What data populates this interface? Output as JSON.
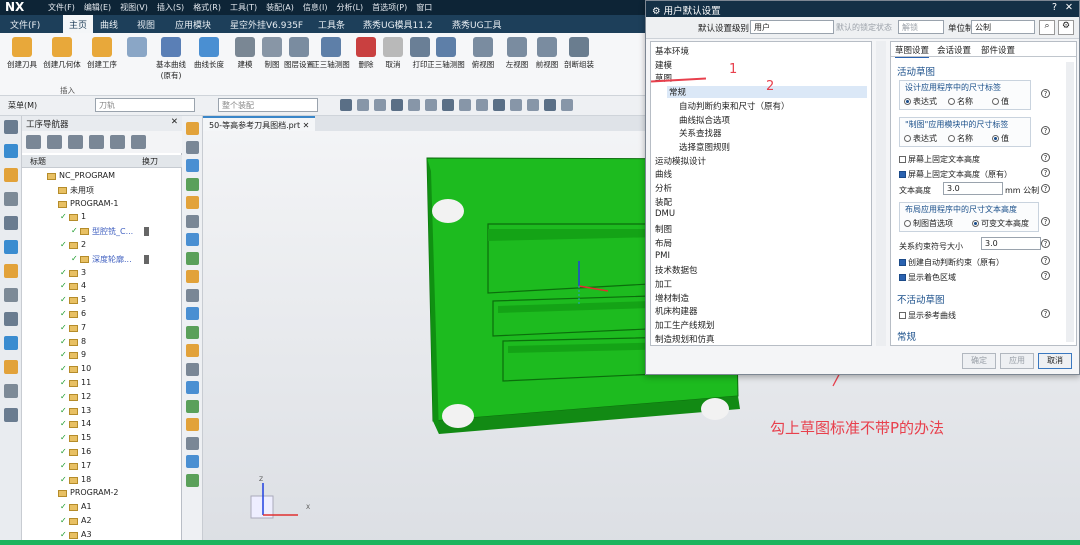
{
  "app": {
    "logo": "NX",
    "menu": [
      "文件(F)",
      "编辑(E)",
      "视图(V)",
      "插入(S)",
      "格式(R)",
      "工具(T)",
      "装配(A)",
      "信息(I)",
      "分析(L)",
      "首选项(P)",
      "窗口"
    ]
  },
  "ribbon_tabs": [
    "文件(F)",
    "主页",
    "曲线",
    "视图",
    "应用模块",
    "星空外挂V6.935F",
    "工具条",
    "燕秀UG模具11.2",
    "燕秀UG工具"
  ],
  "ribbon_buttons": [
    "创建刀具",
    "创建几何体",
    "创建工序",
    "",
    "基本曲线\n(原有)",
    "曲线长度",
    "建模",
    "制图",
    "图层设置",
    "正三轴测图",
    "删除",
    "取消",
    "打印",
    "正三轴测图",
    "俯视图",
    "左视图",
    "前视图",
    "剖断组装"
  ],
  "ribbon_group_label": "插入",
  "toolbar2": {
    "menu_label": "菜单(M)",
    "filter": "刀轨",
    "assembly": "整个装配"
  },
  "navigator": {
    "title": "工序导航器",
    "col_title": "标题",
    "col_tool": "换刀",
    "rows": [
      {
        "indent": 0,
        "label": "NC_PROGRAM"
      },
      {
        "indent": 1,
        "label": "未用项"
      },
      {
        "indent": 1,
        "label": "PROGRAM-1"
      },
      {
        "indent": 2,
        "label": "1"
      },
      {
        "indent": 3,
        "label": "型腔铣_C...",
        "blue": true
      },
      {
        "indent": 2,
        "label": "2"
      },
      {
        "indent": 3,
        "label": "深度轮廓...",
        "blue": true
      },
      {
        "indent": 2,
        "label": "3"
      },
      {
        "indent": 2,
        "label": "4"
      },
      {
        "indent": 2,
        "label": "5"
      },
      {
        "indent": 2,
        "label": "6"
      },
      {
        "indent": 2,
        "label": "7"
      },
      {
        "indent": 2,
        "label": "8"
      },
      {
        "indent": 2,
        "label": "9"
      },
      {
        "indent": 2,
        "label": "10"
      },
      {
        "indent": 2,
        "label": "11"
      },
      {
        "indent": 2,
        "label": "12"
      },
      {
        "indent": 2,
        "label": "13"
      },
      {
        "indent": 2,
        "label": "14"
      },
      {
        "indent": 2,
        "label": "15"
      },
      {
        "indent": 2,
        "label": "16"
      },
      {
        "indent": 2,
        "label": "17"
      },
      {
        "indent": 2,
        "label": "18"
      },
      {
        "indent": 1,
        "label": "PROGRAM-2"
      },
      {
        "indent": 2,
        "label": "A1"
      },
      {
        "indent": 2,
        "label": "A2"
      },
      {
        "indent": 2,
        "label": "A3"
      }
    ]
  },
  "graphics": {
    "tab_label": "50-等高参考刀具图档.prt",
    "axis_x": "X",
    "axis_z": "Z",
    "annotation": "勾上草图标准不带P的办法",
    "colors": {
      "part": "#19c21b",
      "annotation": "#e8404d"
    }
  },
  "dialog": {
    "title": "用户默认设置",
    "level_label": "默认设置级别",
    "level_value": "用户",
    "state_label": "默认的锁定状态",
    "state_value": "解锁",
    "unit_label": "单位制",
    "unit_value": "公制",
    "categories": [
      "基本环境",
      "建模",
      "草图",
      "常规",
      "自动判断约束和尺寸（原有）",
      "曲线拟合选项",
      "关系查找器",
      "选择意图规则",
      "运动模拟设计",
      "曲线",
      "分析",
      "装配",
      "DMU",
      "制图",
      "布局",
      "PMI",
      "技术数据包",
      "加工",
      "增材制造",
      "机床构建器",
      "加工生产线规划",
      "制造规划和仿真"
    ],
    "tabs": [
      "草图设置",
      "会话设置",
      "部件设置"
    ],
    "sec_active": "活动草图",
    "grp1_title": "设计应用程序中的尺寸标签",
    "grp1_opts": [
      "表达式",
      "名称",
      "值"
    ],
    "grp2_title": "\"制图\"应用模块中的尺寸标签",
    "grp2_opts": [
      "表达式",
      "名称",
      "值"
    ],
    "cb_fixed": "屏幕上固定文本高度",
    "cb_fixed_old": "屏幕上固定文本高度（原有）",
    "text_height_label": "文本高度",
    "text_height_value": "3.0",
    "text_height_unit": "mm 公制",
    "grp3_title": "布局应用程序中的尺寸文本高度",
    "grp3_opts": [
      "制图首选项",
      "可变文本高度"
    ],
    "rel_label": "关系约束符号大小",
    "rel_value": "3.0",
    "cb_auto": "创建自动判断约束（原有）",
    "cb_shade": "显示着色区域",
    "sec_inactive": "不活动草图",
    "cb_ref": "显示参考曲线",
    "sec_general": "常规",
    "btn_ok": "确定",
    "btn_apply": "应用",
    "btn_cancel": "取消",
    "marks": [
      "1",
      "2"
    ]
  }
}
